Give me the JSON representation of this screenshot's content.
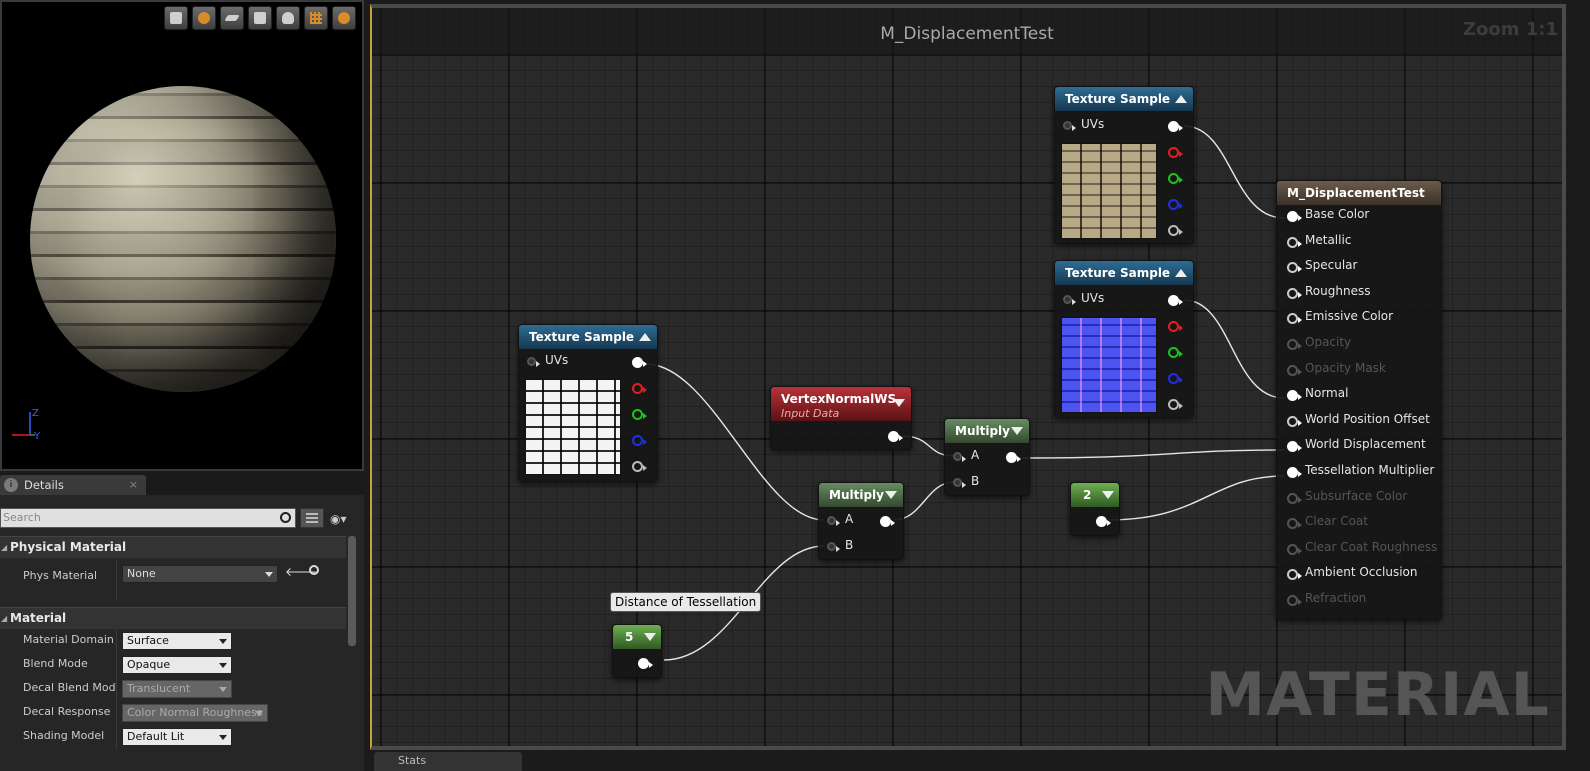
{
  "viewport": {
    "toolbar_icons": [
      "cylinder-icon",
      "sphere-icon",
      "plane-icon",
      "cube-icon",
      "teapot-icon",
      "grid-icon",
      "realtime-icon"
    ],
    "axis": {
      "z": "Z",
      "y": "Y"
    }
  },
  "details": {
    "tab_label": "Details",
    "tab_close": "×",
    "search_placeholder": "Search",
    "categories": {
      "physical": "Physical Material",
      "material": "Material"
    },
    "phys_material": {
      "label": "Phys Material",
      "value": "None"
    },
    "material_props": [
      {
        "label": "Material Domain",
        "value": "Surface"
      },
      {
        "label": "Blend Mode",
        "value": "Opaque"
      },
      {
        "label": "Decal Blend Mode",
        "value": "Translucent"
      },
      {
        "label": "Decal Response",
        "value": "Color Normal Roughness"
      },
      {
        "label": "Shading Model",
        "value": "Default Lit"
      }
    ]
  },
  "graph": {
    "title": "M_DisplacementTest",
    "zoom": "Zoom 1:1",
    "watermark": "MATERIAL",
    "bottom_tab": "Stats",
    "nodes": {
      "tex1": {
        "title": "Texture Sample",
        "input": "UVs"
      },
      "tex2": {
        "title": "Texture Sample",
        "input": "UVs"
      },
      "tex3": {
        "title": "Texture Sample",
        "input": "UVs"
      },
      "vertex": {
        "title": "VertexNormalWS",
        "subtitle": "Input Data"
      },
      "mul1": {
        "title": "Multiply",
        "a": "A",
        "b": "B"
      },
      "mul2": {
        "title": "Multiply",
        "a": "A",
        "b": "B"
      },
      "const5": {
        "value": "5"
      },
      "const2": {
        "value": "2"
      },
      "tooltip": "Distance of Tessellation"
    },
    "result": {
      "title": "M_DisplacementTest",
      "pins": [
        {
          "label": "Base Color",
          "state": "connected"
        },
        {
          "label": "Metallic",
          "state": "active"
        },
        {
          "label": "Specular",
          "state": "active"
        },
        {
          "label": "Roughness",
          "state": "active"
        },
        {
          "label": "Emissive Color",
          "state": "active"
        },
        {
          "label": "Opacity",
          "state": "disabled"
        },
        {
          "label": "Opacity Mask",
          "state": "disabled"
        },
        {
          "label": "Normal",
          "state": "connected"
        },
        {
          "label": "World Position Offset",
          "state": "active"
        },
        {
          "label": "World Displacement",
          "state": "connected"
        },
        {
          "label": "Tessellation Multiplier",
          "state": "connected"
        },
        {
          "label": "Subsurface Color",
          "state": "disabled"
        },
        {
          "label": "Clear Coat",
          "state": "disabled"
        },
        {
          "label": "Clear Coat Roughness",
          "state": "disabled"
        },
        {
          "label": "Ambient Occlusion",
          "state": "active"
        },
        {
          "label": "Refraction",
          "state": "disabled"
        }
      ]
    }
  }
}
